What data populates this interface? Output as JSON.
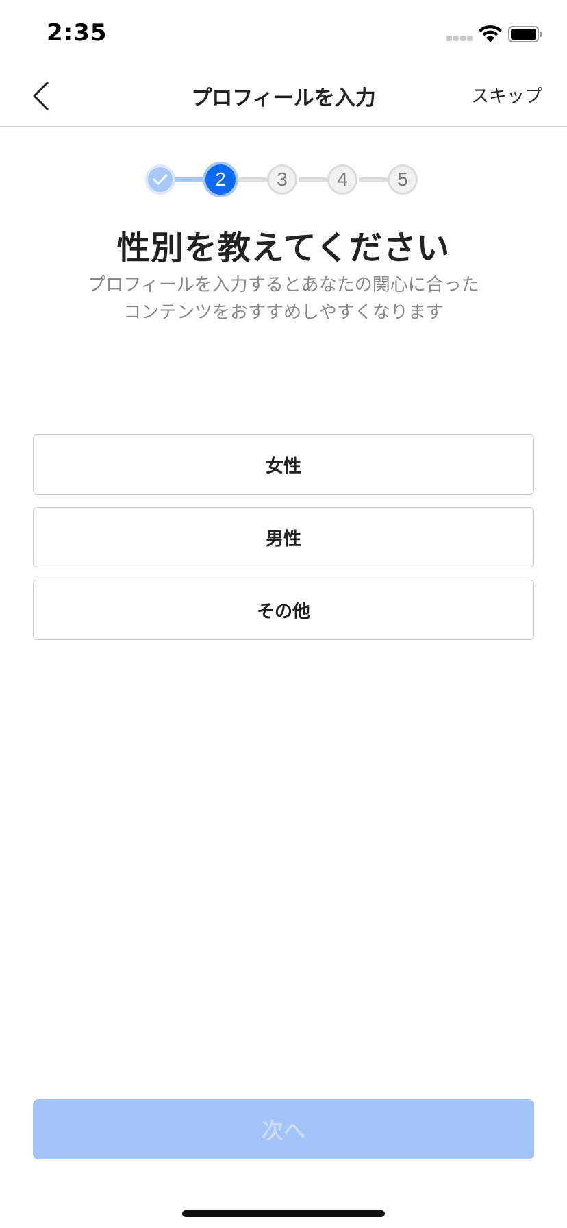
{
  "status_bar": {
    "time": "2:35"
  },
  "nav": {
    "title": "プロフィールを入力",
    "skip_label": "スキップ",
    "back_icon": "chevron-left-icon"
  },
  "stepper": {
    "current_step": 2,
    "total_steps": 5,
    "steps": [
      {
        "label": "",
        "state": "done"
      },
      {
        "label": "2",
        "state": "current"
      },
      {
        "label": "3",
        "state": "todo"
      },
      {
        "label": "4",
        "state": "todo"
      },
      {
        "label": "5",
        "state": "todo"
      }
    ]
  },
  "question": {
    "title": "性別を教えてください",
    "description_line1": "プロフィールを入力するとあなたの関心に合った",
    "description_line2": "コンテンツをおすすめしやすくなります"
  },
  "options": [
    {
      "label": "女性"
    },
    {
      "label": "男性"
    },
    {
      "label": "その他"
    }
  ],
  "footer": {
    "next_label": "次へ",
    "next_enabled": false
  },
  "colors": {
    "accent": "#0a6af0",
    "accent_light": "#a8c8f8",
    "disabled_button": "#a3c4f8",
    "text_primary": "#222222",
    "text_secondary": "#888888"
  }
}
